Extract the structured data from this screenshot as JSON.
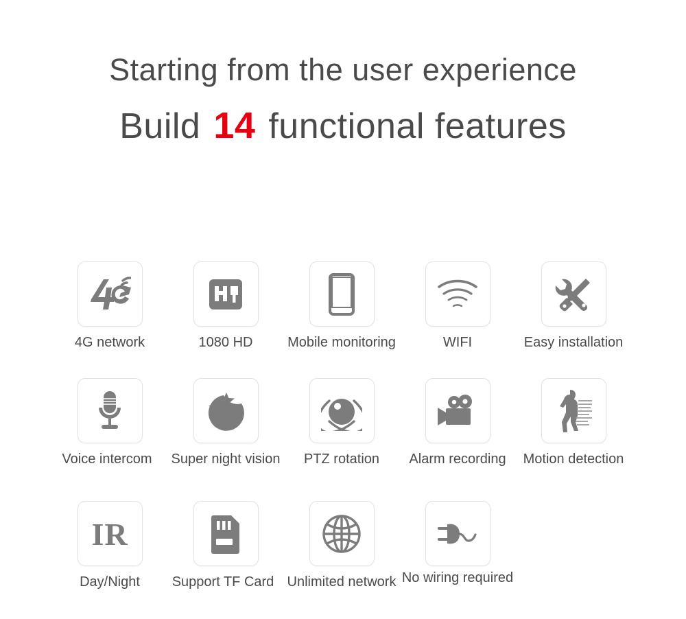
{
  "headline": {
    "line1": "Starting from the user experience",
    "line2_prefix": "Build",
    "line2_number": "14",
    "line2_suffix": "functional features",
    "accent_color": "#e60012",
    "text_color": "#4a4a4a"
  },
  "theme": {
    "background": "#ffffff",
    "icon_gray": "#7c7c7c",
    "tile_border": "#e2e2e2",
    "label_color": "#4a4a4a"
  },
  "features": [
    {
      "label": "4G network",
      "icon": "4g-network-icon",
      "row": 1,
      "col": 1
    },
    {
      "label": "1080 HD",
      "icon": "hd-quality-icon",
      "row": 1,
      "col": 2
    },
    {
      "label": "Mobile monitoring",
      "icon": "smartphone-icon",
      "row": 1,
      "col": 3
    },
    {
      "label": "WIFI",
      "icon": "wifi-icon",
      "row": 1,
      "col": 4
    },
    {
      "label": "Easy installation",
      "icon": "tools-icon",
      "row": 1,
      "col": 5
    },
    {
      "label": "Voice intercom",
      "icon": "microphone-icon",
      "row": 2,
      "col": 1
    },
    {
      "label": "Super night vision",
      "icon": "moon-stars-icon",
      "row": 2,
      "col": 2
    },
    {
      "label": "PTZ rotation",
      "icon": "orbit-sphere-icon",
      "row": 2,
      "col": 3
    },
    {
      "label": "Alarm recording",
      "icon": "movie-camera-icon",
      "row": 2,
      "col": 4
    },
    {
      "label": "Motion detection",
      "icon": "walking-person-icon",
      "row": 2,
      "col": 5
    },
    {
      "label": "Day/Night",
      "icon": "ir-text-icon",
      "row": 3,
      "col": 1
    },
    {
      "label": "Support TF Card",
      "icon": "memory-card-icon",
      "row": 3,
      "col": 2
    },
    {
      "label": "Unlimited network",
      "icon": "globe-icon",
      "row": 3,
      "col": 3
    },
    {
      "label": "No wiring required",
      "icon": "power-plug-icon",
      "row": 3,
      "col": 4
    }
  ]
}
